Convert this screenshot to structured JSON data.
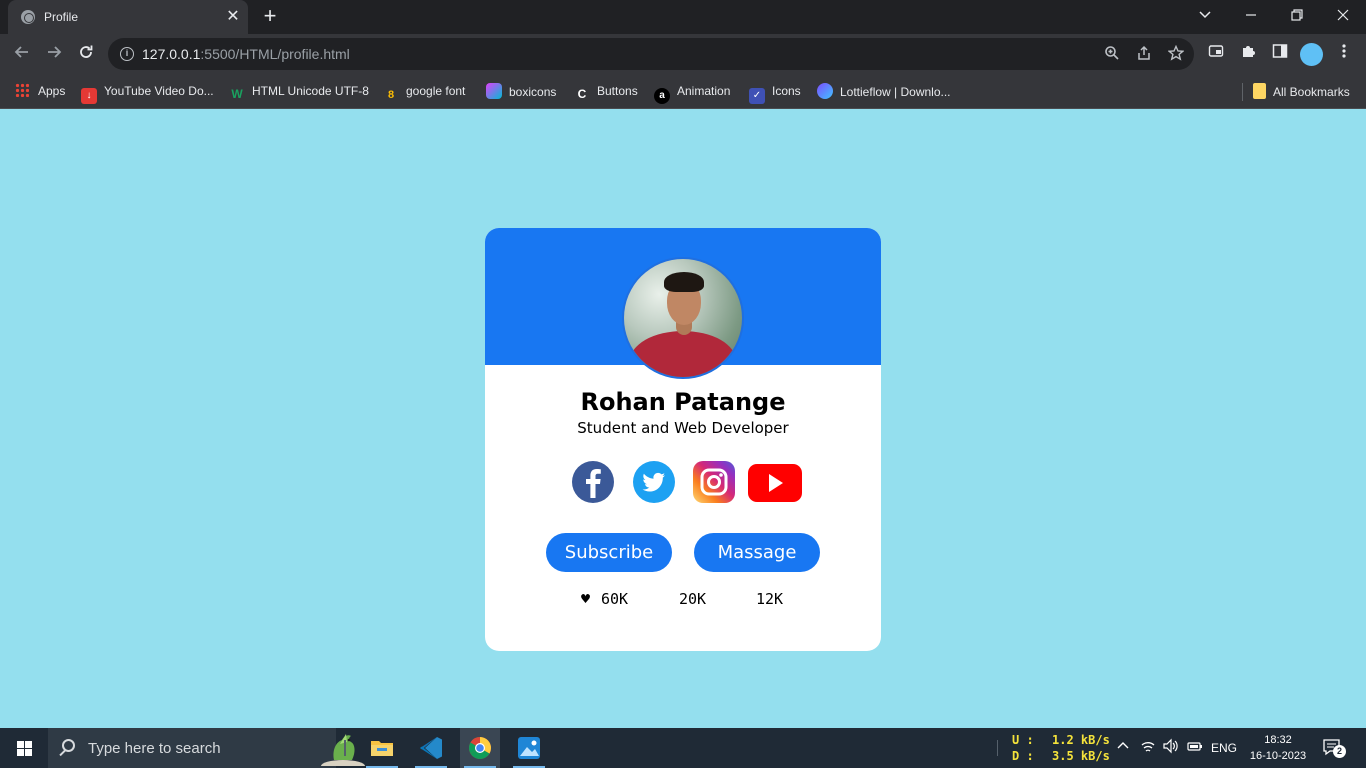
{
  "browser": {
    "tab": {
      "title": "Profile",
      "close_glyph": "✕"
    },
    "new_tab_glyph": "+",
    "address": {
      "host": "127.0.0.1",
      "path": ":5500/HTML/profile.html"
    },
    "bookmarks": [
      {
        "label": "Apps",
        "icon": "apps-grid-icon",
        "color": "#ea4335"
      },
      {
        "label": "YouTube Video Do...",
        "icon": "download-icon",
        "color": "#e53935"
      },
      {
        "label": "HTML Unicode UTF-8",
        "icon": "w3-icon",
        "color": "#1aa260"
      },
      {
        "label": "google font",
        "icon": "google-fonts-icon",
        "color": "#fbbc04"
      },
      {
        "label": "boxicons",
        "icon": "boxicons-icon",
        "color": "#e040fb"
      },
      {
        "label": "Buttons",
        "icon": "c-icon",
        "color": "#ffffff"
      },
      {
        "label": "Animation",
        "icon": "animation-icon",
        "color": "#000000"
      },
      {
        "label": "Icons",
        "icon": "icons-icon",
        "color": "#3f51b5"
      },
      {
        "label": "Lottieflow | Downlo...",
        "icon": "lottie-icon",
        "color": "#7c4dff"
      }
    ],
    "all_bookmarks_label": "All Bookmarks"
  },
  "profile": {
    "name": "Rohan Patange",
    "role": "Student and Web Developer",
    "socials": [
      "facebook-icon",
      "twitter-icon",
      "instagram-icon",
      "youtube-icon"
    ],
    "buttons": {
      "subscribe": "Subscribe",
      "message": "Massage"
    },
    "stats": {
      "heart": "♥",
      "likes": "60K",
      "second": "20K",
      "third": "12K"
    },
    "colors": {
      "accent": "#1877f2",
      "background": "#94dfee",
      "card": "#ffffff"
    }
  },
  "taskbar": {
    "search_placeholder": "Type here to search",
    "net": {
      "up_label": "U :",
      "up_value": "1.2 kB/s",
      "down_label": "D :",
      "down_value": "3.5 kB/s"
    },
    "lang": "ENG",
    "time": "18:32",
    "date": "16-10-2023",
    "notifications": "2"
  }
}
